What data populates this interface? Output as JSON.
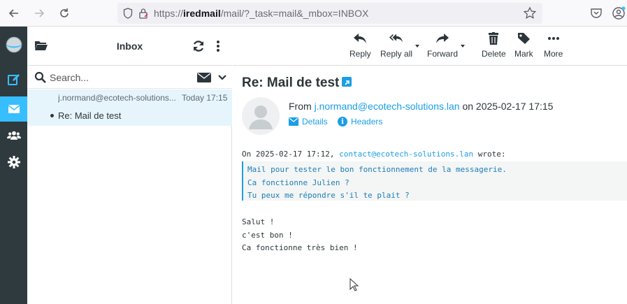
{
  "browser": {
    "url_prefix": "https://",
    "url_host": "iredmail",
    "url_path": "/mail/?_task=mail&_mbox=INBOX"
  },
  "rail": {
    "items": [
      "logo",
      "compose",
      "mail",
      "contacts",
      "settings"
    ],
    "active": "mail",
    "accent_color": "#37beff",
    "bg_color": "#2f3a3f"
  },
  "list": {
    "title": "Inbox",
    "search_placeholder": "Search...",
    "messages": [
      {
        "from": "j.normand@ecotech-solutions...",
        "date": "Today 17:15",
        "subject": "Re: Mail de test",
        "selected": true
      }
    ]
  },
  "toolbar": {
    "reply": "Reply",
    "reply_all": "Reply all",
    "forward": "Forward",
    "delete": "Delete",
    "mark": "Mark",
    "more": "More"
  },
  "message": {
    "subject": "Re: Mail de test",
    "from_label": "From",
    "from_address": "j.normand@ecotech-solutions.lan",
    "on_label": "on",
    "date": "2025-02-17 17:15",
    "details_label": "Details",
    "headers_label": "Headers",
    "quote_intro_prefix": "On 2025-02-17 17:12,",
    "quote_intro_address": "contact@ecotech-solutions.lan",
    "quote_intro_suffix": "wrote:",
    "quoted_lines": [
      "Mail pour tester le bon fonctionnement de la messagerie.",
      "Ca fonctionne Julien ?",
      "Tu peux me répondre s'il te plait ?"
    ],
    "body_lines": [
      "Salut !",
      "c'est bon !",
      "Ca fonctionne très bien !"
    ]
  }
}
